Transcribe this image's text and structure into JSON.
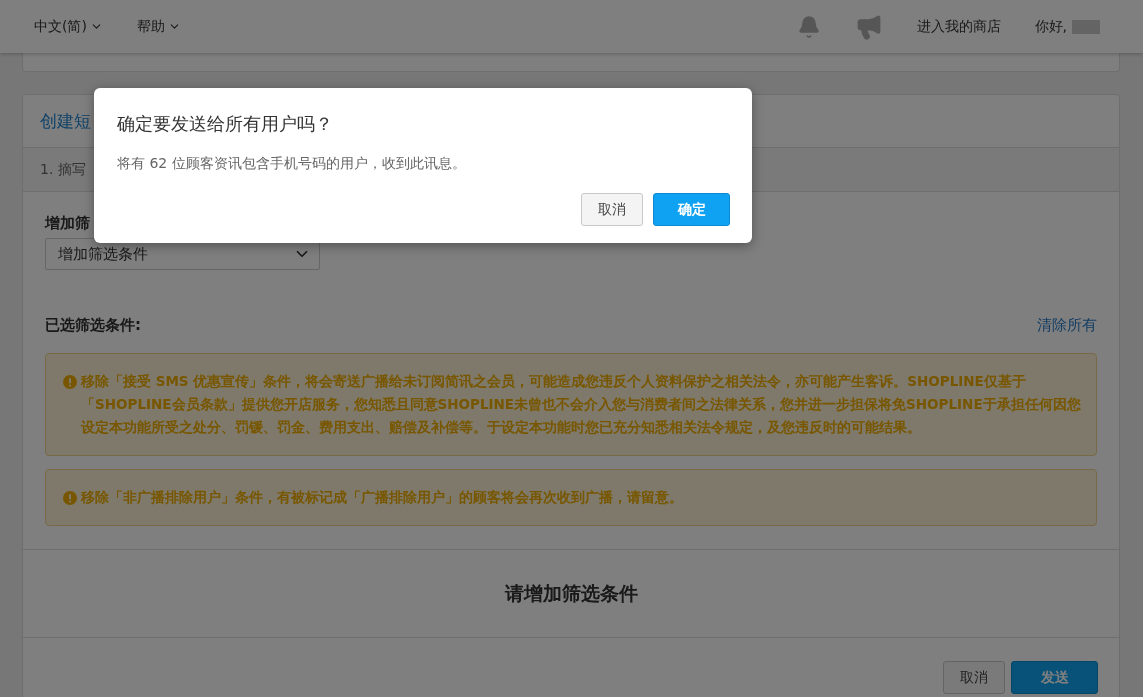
{
  "top_bar": {
    "menus": [
      {
        "label": "中文(简)"
      },
      {
        "label": "帮助"
      }
    ],
    "store_link": "进入我的商店",
    "greeting": "你好,"
  },
  "card": {
    "title": "创建短",
    "step": "1. 摘写",
    "filter_label": "增加筛",
    "filter_select": {
      "value": "增加筛选条件"
    },
    "selected_label": "已选筛选条件:",
    "clear_all": "清除所有",
    "warnings": [
      {
        "text": "移除「接受 SMS 优惠宣传」条件，将会寄送广播给未订阅简讯之会员，可能造成您违反个人资料保护之相关法令，亦可能产生客诉。SHOPLINE仅基于「SHOPLINE会员条款」提供您开店服务，您知悉且同意SHOPLINE未曾也不会介入您与消费者间之法律关系，您并进一步担保将免SHOPLINE于承担任何因您设定本功能所受之处分、罚锾、罚金、费用支出、赔偿及补偿等。于设定本功能时您已充分知悉相关法令规定，及您违反时的可能结果。"
      },
      {
        "text": "移除「非广播排除用户」条件，有被标记成「广播排除用户」的顾客将会再次收到广播，请留意。"
      }
    ],
    "empty_message": "请增加筛选条件",
    "buttons": [
      {
        "label": "取消",
        "kind": "secondary"
      },
      {
        "label": "发送",
        "kind": "primary"
      }
    ]
  },
  "dialog": {
    "title": "确定要发送给所有用户吗？",
    "message": "将有 62 位顾客资讯包含手机号码的用户，收到此讯息。",
    "buttons": [
      {
        "label": "取消",
        "kind": "secondary"
      },
      {
        "label": "确定",
        "kind": "primary"
      }
    ]
  }
}
